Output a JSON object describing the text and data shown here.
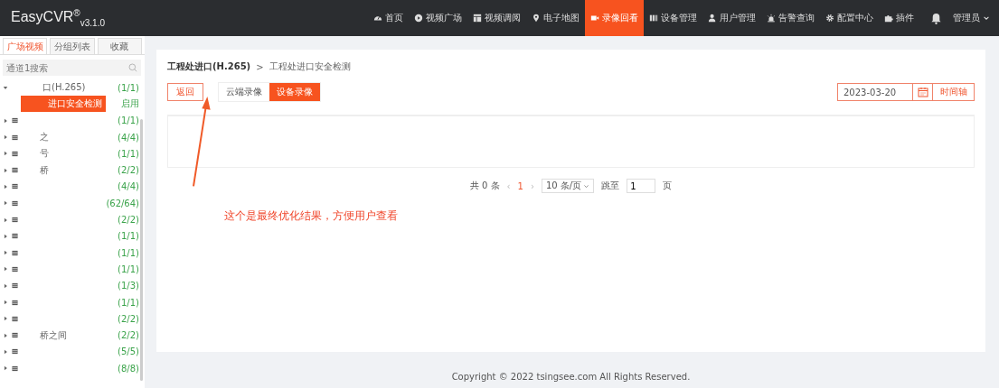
{
  "app": {
    "name": "EasyCVR",
    "trademark": "®",
    "version": "v3.1.0"
  },
  "nav": [
    {
      "label": "首页",
      "kind": "gauge",
      "selected": false
    },
    {
      "label": "视频广场",
      "kind": "play",
      "selected": false
    },
    {
      "label": "视频调阅",
      "kind": "layout",
      "selected": false
    },
    {
      "label": "电子地图",
      "kind": "pin",
      "selected": false
    },
    {
      "label": "录像回看",
      "kind": "camera",
      "selected": true
    },
    {
      "label": "设备管理",
      "kind": "columns",
      "selected": false
    },
    {
      "label": "用户管理",
      "kind": "user",
      "selected": false
    },
    {
      "label": "告警查询",
      "kind": "alarm",
      "selected": false
    },
    {
      "label": "配置中心",
      "kind": "gear",
      "selected": false
    },
    {
      "label": "插件",
      "kind": "puzzle",
      "selected": false
    }
  ],
  "user": {
    "label": "管理员"
  },
  "sidebar": {
    "tabs": [
      {
        "label": "广场视频",
        "selected": true
      },
      {
        "label": "分组列表",
        "selected": false
      },
      {
        "label": "收藏",
        "selected": false
      }
    ],
    "search": {
      "placeholder": "通道1搜索"
    },
    "tree": [
      {
        "label": "口(H.265)",
        "count": "(1/1)",
        "expanded": true,
        "children": [
          {
            "label": "进口安全检测",
            "status": "启用",
            "selected": true
          }
        ]
      },
      {
        "count": "(1/1)",
        "expanded": false
      },
      {
        "label": "之",
        "count": "(4/4)",
        "expanded": false
      },
      {
        "label": "号",
        "count": "(1/1)",
        "expanded": false
      },
      {
        "label": "桥",
        "count": "(2/2)",
        "expanded": false
      },
      {
        "count": "(4/4)",
        "expanded": false
      },
      {
        "count": "(62/64)",
        "expanded": false
      },
      {
        "count": "(2/2)",
        "expanded": false
      },
      {
        "count": "(1/1)",
        "expanded": false
      },
      {
        "count": "(1/1)",
        "expanded": false
      },
      {
        "count": "(1/1)",
        "expanded": false
      },
      {
        "count": "(1/3)",
        "expanded": false
      },
      {
        "count": "(1/1)",
        "expanded": false
      },
      {
        "count": "(2/2)",
        "expanded": false
      },
      {
        "label": "桥之间",
        "count": "(2/2)",
        "expanded": false
      },
      {
        "count": "(5/5)",
        "expanded": false
      },
      {
        "count": "(8/8)",
        "expanded": false
      }
    ]
  },
  "breadcrumb": {
    "parent": "工程处进口(H.265)",
    "separator": ">",
    "current": "工程处进口安全检测"
  },
  "actions": {
    "back": "返回",
    "sources": [
      {
        "label": "云端录像",
        "selected": false
      },
      {
        "label": "设备录像",
        "selected": true
      }
    ],
    "date": "2023-03-20",
    "timeline": "时间轴"
  },
  "pagination": {
    "total": "共 0 条",
    "prev": "‹",
    "page": "1",
    "next": "›",
    "page_size": "10 条/页",
    "jump_label": "跳至",
    "jump_value": "1",
    "page_unit": "页"
  },
  "annotation": {
    "text": "这个是最终优化结果，方便用户查看"
  },
  "footer": "Copyright © 2022 tsingsee.com All Rights Reserved."
}
